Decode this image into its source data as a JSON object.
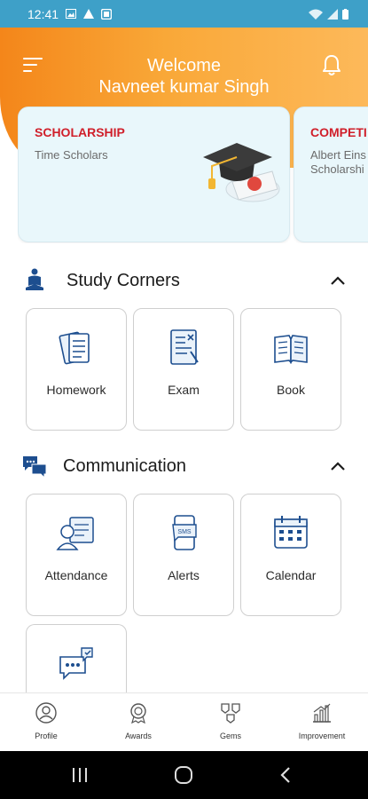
{
  "status_bar": {
    "time": "12:41"
  },
  "header": {
    "welcome": "Welcome",
    "user_name": "Navneet kumar Singh"
  },
  "cards": [
    {
      "title": "SCHOLARSHIP",
      "subtitle": "Time Scholars"
    },
    {
      "title": "COMPETI",
      "subtitle_line1": "Albert Eins",
      "subtitle_line2": "Scholarshi"
    }
  ],
  "study_corners": {
    "title": "Study Corners",
    "items": [
      {
        "label": "Homework"
      },
      {
        "label": "Exam"
      },
      {
        "label": "Book"
      }
    ]
  },
  "communication": {
    "title": "Communication",
    "items": [
      {
        "label": "Attendance"
      },
      {
        "label": "Alerts"
      },
      {
        "label": "Calendar"
      },
      {
        "label": ""
      }
    ]
  },
  "bottom_nav": {
    "items": [
      {
        "label": "Profile"
      },
      {
        "label": "Awards"
      },
      {
        "label": "Gems"
      },
      {
        "label": "Improvement"
      }
    ]
  },
  "colors": {
    "header_orange": "#f4861a",
    "accent_blue": "#1d4e8f",
    "status_bar": "#3ea0c8",
    "card_title_red": "#d01f2a"
  }
}
